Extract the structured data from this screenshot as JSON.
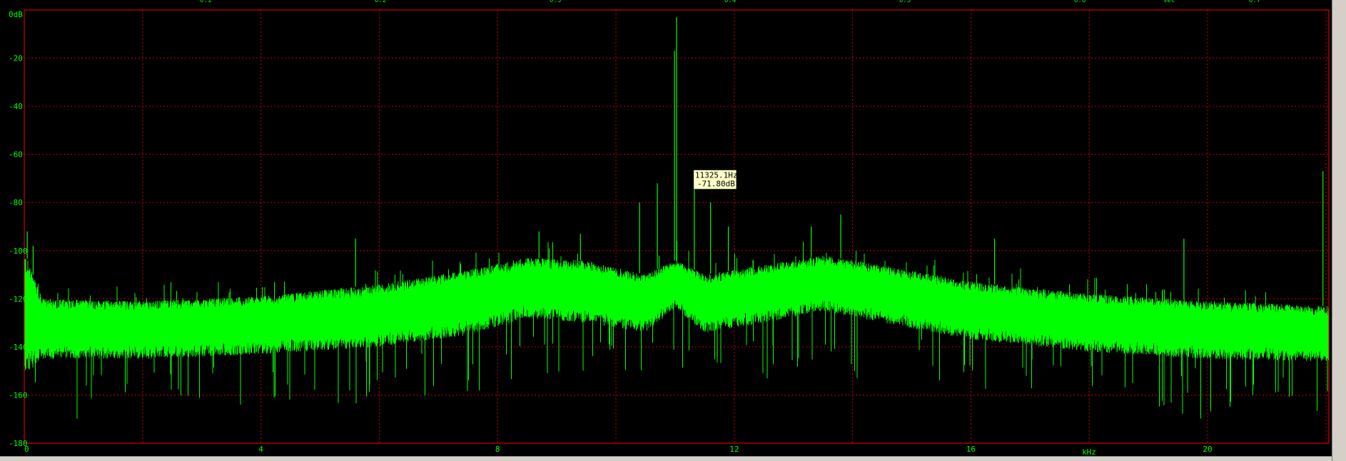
{
  "top_strip": {
    "labels": [
      "0.1",
      "0.2",
      "0.3",
      "0.4",
      "0.5",
      "0.6",
      "sec",
      "0.7"
    ]
  },
  "chart_data": {
    "type": "line",
    "title": "",
    "xlabel": "kHz",
    "ylabel": "",
    "xlim": [
      0,
      22.05
    ],
    "ylim": [
      -180,
      0
    ],
    "x_ticks": [
      0,
      4,
      8,
      12,
      16,
      20
    ],
    "x_tick_labels": [
      "0",
      "4",
      "8",
      "12",
      "16",
      "20"
    ],
    "y_ticks": [
      0,
      -20,
      -40,
      -60,
      -80,
      -100,
      -120,
      -140,
      -160,
      -180
    ],
    "y_tick_labels": [
      "0dB",
      "-20",
      "-40",
      "-60",
      "-80",
      "-100",
      "-120",
      "-140",
      "-160",
      "-180"
    ],
    "grid": true,
    "colors": {
      "trace": "#00ff00",
      "grid": "#c80000",
      "frame": "#ff0000",
      "background": "#000000",
      "label_bg": "#ffffc8",
      "label_text": "#000000"
    },
    "noise_floor_profile": {
      "x": [
        0,
        0.3,
        2,
        4,
        6,
        7.5,
        8.5,
        9.5,
        10.5,
        11,
        11.5,
        12.5,
        13.5,
        14.5,
        16,
        18,
        20,
        22
      ],
      "upper_db": [
        -100,
        -120,
        -121,
        -119,
        -114,
        -108,
        -103,
        -104,
        -110,
        -104,
        -110,
        -106,
        -102,
        -106,
        -113,
        -118,
        -121,
        -123
      ],
      "lower_db": [
        -152,
        -145,
        -145,
        -143,
        -140,
        -135,
        -128,
        -130,
        -134,
        -124,
        -134,
        -130,
        -125,
        -130,
        -137,
        -142,
        -145,
        -146
      ]
    },
    "series": [
      {
        "values": [
          {
            "x": 11.025,
            "y": -3
          },
          {
            "x": 10.99,
            "y": -17
          },
          {
            "x": 11.325,
            "y": -72
          },
          {
            "x": 10.7,
            "y": -72
          },
          {
            "x": 10.4,
            "y": -80
          },
          {
            "x": 11.6,
            "y": -80
          },
          {
            "x": 13.8,
            "y": -85
          },
          {
            "x": 11.9,
            "y": -90
          },
          {
            "x": 9.4,
            "y": -93
          },
          {
            "x": 8.7,
            "y": -92
          },
          {
            "x": 13.3,
            "y": -90
          },
          {
            "x": 5.6,
            "y": -95
          },
          {
            "x": 16.4,
            "y": -95
          },
          {
            "x": 19.6,
            "y": -95
          },
          {
            "x": 21.95,
            "y": -67
          },
          {
            "x": 0.05,
            "y": -92
          },
          {
            "x": 0.15,
            "y": -98
          }
        ]
      }
    ],
    "annotation": {
      "frequency": "11325.1Hz",
      "level": "-71.80dB",
      "x": 11.3251,
      "y": -71.8
    }
  }
}
